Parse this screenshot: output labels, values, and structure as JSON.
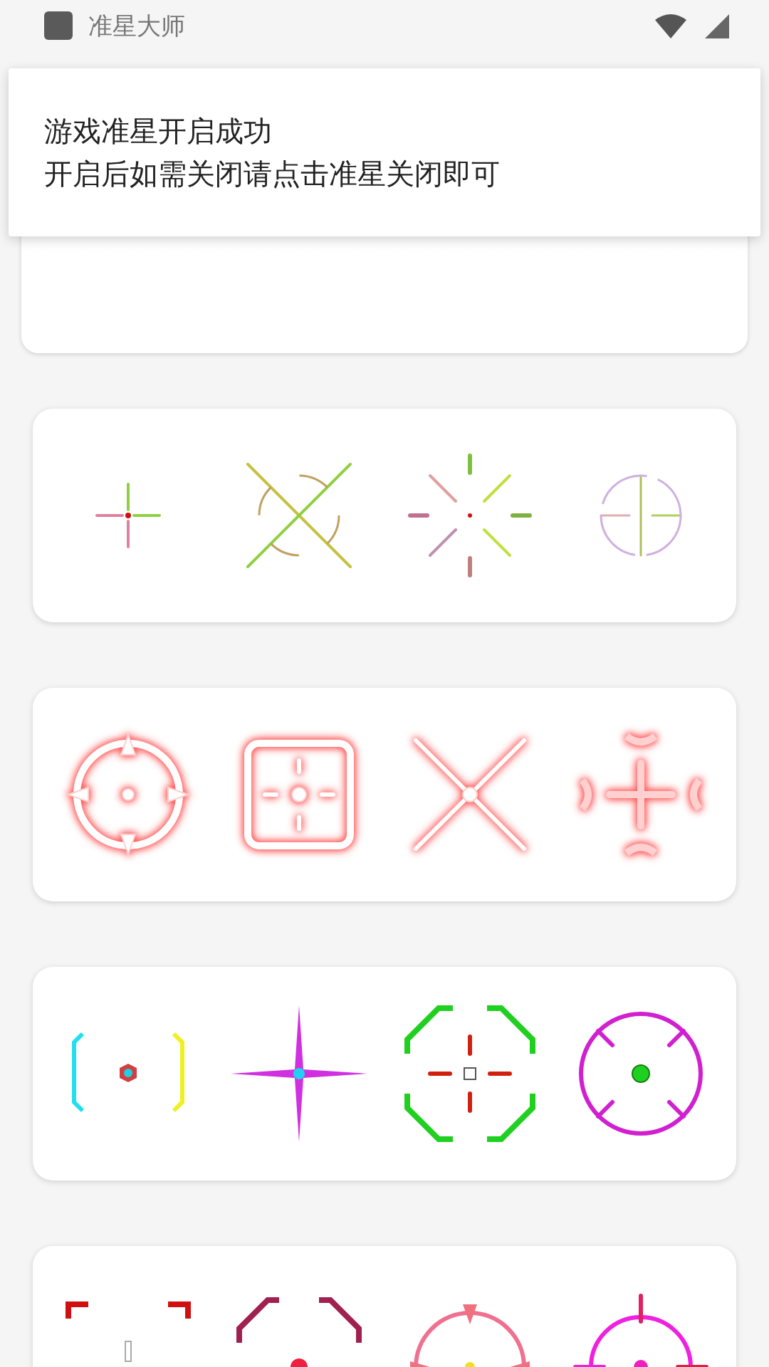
{
  "status_bar": {
    "app_name": "准星大师"
  },
  "toast": {
    "lines": [
      "游戏准星开启成功",
      "开启后如需关闭请点击准星关闭即可"
    ]
  }
}
